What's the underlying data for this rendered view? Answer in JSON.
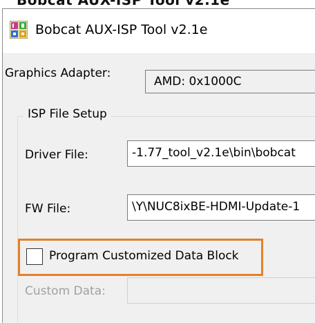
{
  "window": {
    "title": "Bobcat AUX-ISP Tool v2.1e",
    "cut_off_heading": "Bobcat AUX-ISP Tool v2.1e",
    "app_icon": "isp-tool-icon"
  },
  "adapter": {
    "label": "Graphics Adapter:",
    "value": "AMD: 0x1000C"
  },
  "isp_setup": {
    "group_title": "ISP File Setup",
    "driver": {
      "label": "Driver File:",
      "value": "-1.77_tool_v2.1e\\bin\\bobcat"
    },
    "fw": {
      "label": "FW File:",
      "value": "\\Y\\NUC8ixBE-HDMI-Update-1"
    },
    "custom_block": {
      "label": "Program Customized Data Block",
      "checked": false
    },
    "custom_data": {
      "label": "Custom Data:",
      "value": ""
    }
  },
  "colors": {
    "highlight": "#e57f27",
    "window_bg": "#f0f0f0"
  }
}
